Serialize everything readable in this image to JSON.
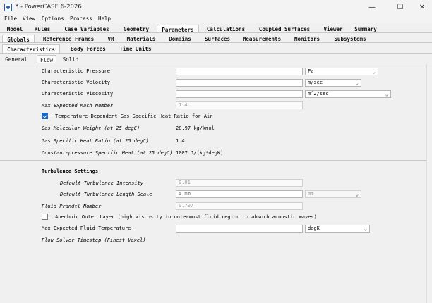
{
  "window": {
    "title": "* - PowerCASE 6-2026",
    "minimize": "—",
    "maximize": "☐",
    "close": "✕"
  },
  "menu": [
    "File",
    "View",
    "Options",
    "Process",
    "Help"
  ],
  "tabs_row1": [
    "Model",
    "Rules",
    "Case Variables",
    "Geometry",
    "Parameters",
    "Calculations",
    "Coupled Surfaces",
    "Viewer",
    "Summary"
  ],
  "tabs_row2": [
    "Globals",
    "Reference Frames",
    "VR",
    "Materials",
    "Domains",
    "Surfaces",
    "Measurements",
    "Monitors",
    "Subsystems"
  ],
  "tabs_row3": [
    "Characteristics",
    "Body Forces",
    "Time Units"
  ],
  "tabs_row4": [
    "General",
    "Flow",
    "Solid"
  ],
  "form": {
    "char_pressure": {
      "label": "Characteristic Pressure",
      "value": "",
      "unit": "Pa"
    },
    "char_velocity": {
      "label": "Characteristic Velocity",
      "value": "",
      "unit": "m/sec"
    },
    "char_viscosity": {
      "label": "Characteristic Viscosity",
      "value": "",
      "unit": "m^2/sec"
    },
    "max_mach": {
      "label": "Max Expected Mach Number",
      "value": "1.4"
    },
    "temp_dependent": {
      "label": "Temperature-Dependent Gas Specific Heat Ratio for Air",
      "checked": true
    },
    "gas_mol_weight": {
      "label": "Gas Molecular Weight (at 25 degC)",
      "value": "28.97 kg/kmol"
    },
    "gas_heat_ratio": {
      "label": "Gas Specific Heat Ratio (at 25 degC)",
      "value": "1.4"
    },
    "const_pressure_heat": {
      "label": "Constant-pressure Specific Heat (at 25 degC)",
      "value": "1007 J/(kg*degK)"
    }
  },
  "turbulence": {
    "heading": "Turbulence Settings",
    "intensity": {
      "label": "Default Turbulence Intensity",
      "value": "0.01"
    },
    "length_scale": {
      "label": "Default Turbulence Length Scale",
      "value": "5 mm",
      "unit": "mm"
    },
    "prandtl": {
      "label": "Fluid Prandtl Number",
      "value": "0.707"
    },
    "anechoic": {
      "label": "Anechoic Outer Layer (high viscosity in outermost fluid region to absorb acoustic waves)",
      "checked": false
    },
    "max_temp": {
      "label": "Max Expected Fluid Temperature",
      "value": "",
      "unit": "degK"
    },
    "timestep": {
      "label": "Flow Solver Timestep (Finest Voxel)"
    }
  }
}
